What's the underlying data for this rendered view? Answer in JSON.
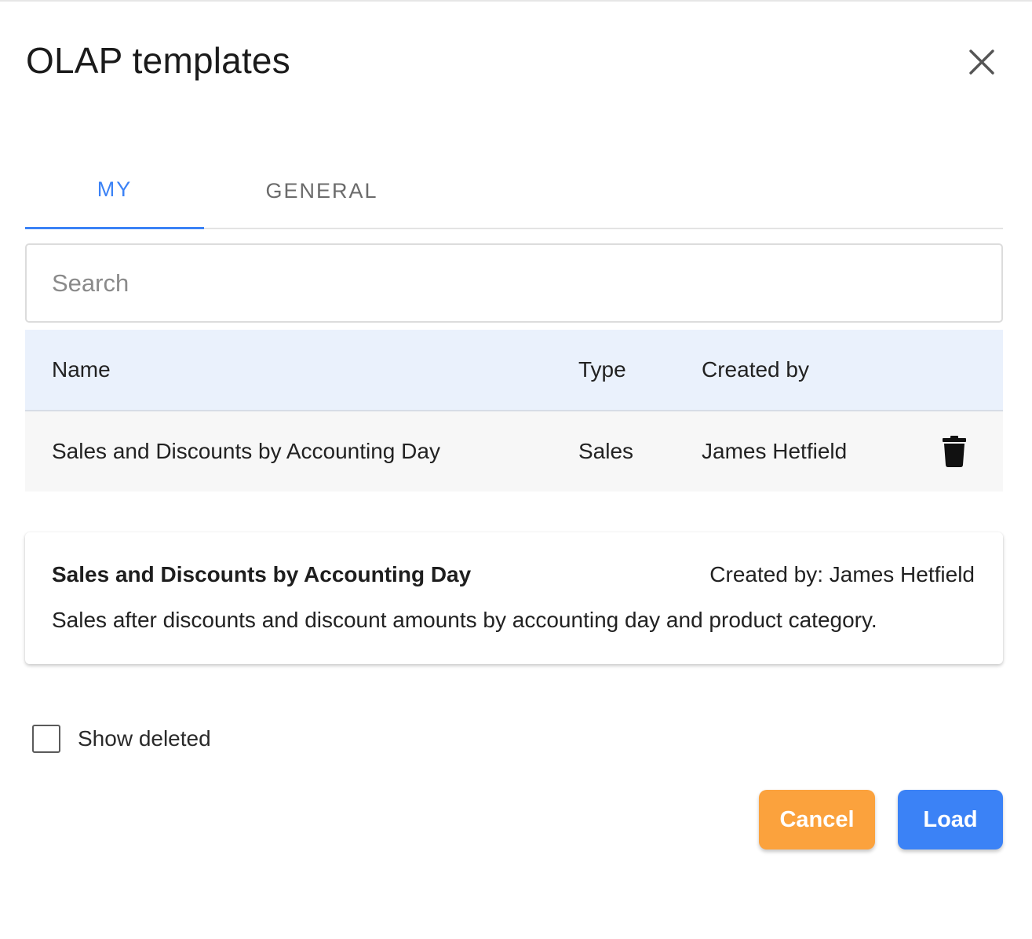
{
  "dialog": {
    "title": "OLAP templates",
    "close_icon": "close-icon"
  },
  "tabs": [
    {
      "label": "MY",
      "active": true
    },
    {
      "label": "GENERAL",
      "active": false
    }
  ],
  "search": {
    "placeholder": "Search",
    "value": ""
  },
  "table": {
    "columns": [
      "Name",
      "Type",
      "Created by"
    ],
    "rows": [
      {
        "name": "Sales and Discounts by Accounting Day",
        "type": "Sales",
        "created_by": "James Hetfield",
        "action_icon": "trash-icon"
      }
    ]
  },
  "details": {
    "title": "Sales and Discounts by Accounting Day",
    "created_by": "Created by: James Hetfield",
    "description": "Sales after discounts and discount amounts by accounting day and product category."
  },
  "show_deleted": {
    "label": "Show deleted",
    "checked": false
  },
  "buttons": {
    "cancel": "Cancel",
    "load": "Load"
  },
  "colors": {
    "accent": "#3b82f6",
    "cancel": "#fba23d",
    "header_bg": "#eaf1fc",
    "row_bg": "#f7f7f7"
  }
}
